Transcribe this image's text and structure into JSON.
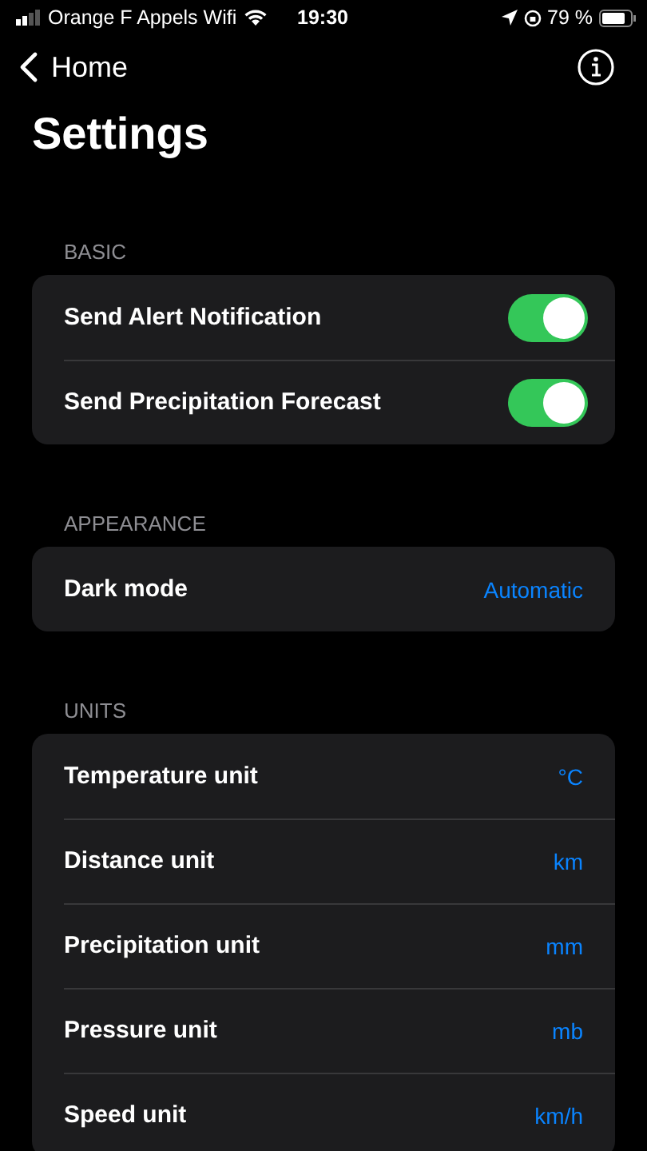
{
  "status_bar": {
    "carrier": "Orange F Appels Wifi",
    "time": "19:30",
    "battery": "79 %"
  },
  "nav": {
    "back": "Home"
  },
  "title": "Settings",
  "sections": [
    {
      "header": "BASIC",
      "rows": [
        {
          "kind": "toggle",
          "label": "Send Alert Notification",
          "on": true
        },
        {
          "kind": "toggle",
          "label": "Send Precipitation Forecast",
          "on": true
        }
      ]
    },
    {
      "header": "APPEARANCE",
      "rows": [
        {
          "kind": "value",
          "label": "Dark mode",
          "value": "Automatic"
        }
      ]
    },
    {
      "header": "UNITS",
      "rows": [
        {
          "kind": "value",
          "label": "Temperature unit",
          "value": "°C"
        },
        {
          "kind": "value",
          "label": "Distance unit",
          "value": "km"
        },
        {
          "kind": "value",
          "label": "Precipitation unit",
          "value": "mm"
        },
        {
          "kind": "value",
          "label": "Pressure unit",
          "value": "mb"
        },
        {
          "kind": "value",
          "label": "Speed unit",
          "value": "km/h"
        }
      ]
    }
  ]
}
